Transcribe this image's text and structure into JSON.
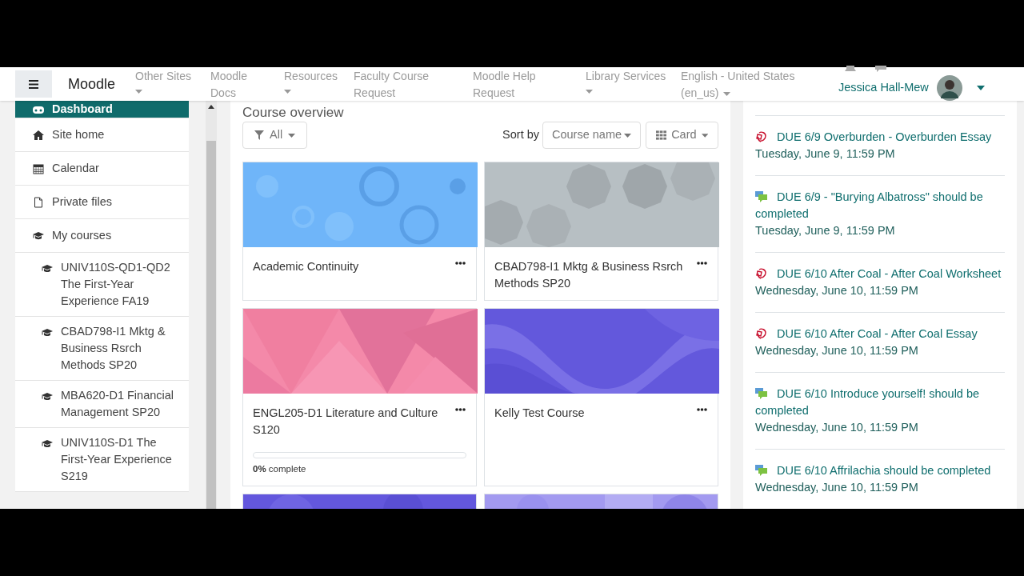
{
  "header": {
    "site_name": "Moodle",
    "nav": [
      {
        "label": "Other Sites",
        "dropdown": true
      },
      {
        "label": "Moodle Docs",
        "dropdown": false
      },
      {
        "label": "Resources",
        "dropdown": true
      },
      {
        "label": "Faculty Course Request",
        "dropdown": false
      },
      {
        "label": "Moodle Help Request",
        "dropdown": false
      },
      {
        "label": "Library Services",
        "dropdown": true
      },
      {
        "label": "English - United States (en_us)",
        "dropdown": true
      }
    ],
    "user_name": "Jessica Hall-Mew"
  },
  "sidebar": {
    "items": [
      {
        "label": "Dashboard",
        "kind": "nav",
        "selected": true
      },
      {
        "label": "Site home",
        "kind": "nav",
        "selected": false
      },
      {
        "label": "Calendar",
        "kind": "nav",
        "selected": false
      },
      {
        "label": "Private files",
        "kind": "nav",
        "selected": false
      },
      {
        "label": "My courses",
        "kind": "nav",
        "selected": false
      },
      {
        "label": "UNIV110S-QD1-QD2 The First-Year Experience FA19",
        "kind": "course",
        "selected": false
      },
      {
        "label": "CBAD798-I1 Mktg & Business Rsrch Methods SP20",
        "kind": "course",
        "selected": false
      },
      {
        "label": "MBA620-D1 Financial Management SP20",
        "kind": "course",
        "selected": false
      },
      {
        "label": "UNIV110S-D1 The First-Year Experience S219",
        "kind": "course",
        "selected": false
      }
    ]
  },
  "course_overview": {
    "title": "Course overview",
    "filter": "All",
    "sort_label": "Sort by",
    "sort": "Course name",
    "view": "Card",
    "cards": [
      {
        "kind": "course",
        "title": "Academic Continuity"
      },
      {
        "kind": "course",
        "title": "CBAD798-I1 Mktg & Business Rsrch Methods SP20"
      },
      {
        "kind": "course",
        "title": "ENGL205-D1 Literature and Culture S120",
        "progress": {
          "level": 0,
          "label": "**0%** complete"
        }
      },
      {
        "kind": "course",
        "title": "Kelly Test Course"
      },
      {
        "kind": "partial"
      },
      {
        "kind": "partial"
      }
    ]
  },
  "upcoming": {
    "events": [
      {
        "kind": "assignment",
        "title": "DUE 6/9 Overburden - Overburden Essay",
        "date": "Tuesday, June 9, 11:59 PM"
      },
      {
        "kind": "forum",
        "title": "DUE 6/9 - \"Burying Albatross\" should be completed",
        "date": "Tuesday, June 9, 11:59 PM"
      },
      {
        "kind": "assignment",
        "title": "DUE 6/10 After Coal - After Coal Worksheet",
        "date": "Wednesday, June 10, 11:59 PM"
      },
      {
        "kind": "assignment",
        "title": "DUE 6/10 After Coal - After Coal Essay",
        "date": "Wednesday, June 10, 11:59 PM"
      },
      {
        "kind": "forum",
        "title": "DUE 6/10 Introduce yourself! should be completed",
        "date": "Wednesday, June 10, 11:59 PM"
      },
      {
        "kind": "forum",
        "title": "DUE 6/10 Affrilachia should be completed",
        "date": "Wednesday, June 10, 11:59 PM"
      }
    ]
  }
}
